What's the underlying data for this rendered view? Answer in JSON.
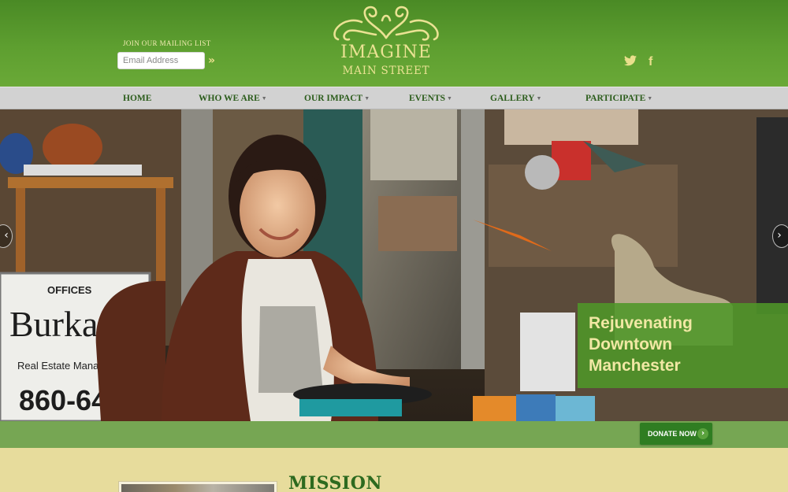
{
  "header": {
    "mailing_label": "JOIN OUR MAILING LIST",
    "email_placeholder": "Email Address",
    "submit_icon": "double-chevron-right-icon",
    "logo_line1": "IMAGINE",
    "logo_line2": "MAIN STREET",
    "social": [
      "twitter-icon",
      "facebook-icon"
    ]
  },
  "nav": {
    "items": [
      {
        "label": "HOME",
        "dropdown": false
      },
      {
        "label": "WHO WE ARE",
        "dropdown": true
      },
      {
        "label": "OUR IMPACT",
        "dropdown": true
      },
      {
        "label": "EVENTS",
        "dropdown": true
      },
      {
        "label": "GALLERY",
        "dropdown": true
      },
      {
        "label": "PARTICIPATE",
        "dropdown": true
      }
    ]
  },
  "hero": {
    "caption_line1": "Rejuvenating",
    "caption_line2": "Downtown",
    "caption_line3": "Manchester",
    "sign_offices": "OFFICES",
    "sign_name": "Burkam",
    "sign_sub": "Real Estate Manage",
    "sign_phone": "860-647"
  },
  "cta": {
    "donate_label": "DONATE NOW"
  },
  "main": {
    "mission_title": "MISSION"
  },
  "colors": {
    "header_green": "#5e9f30",
    "logo_cream": "#eae293",
    "nav_bg": "#d2d2d2",
    "nav_text": "#2c5d1c",
    "bar_green": "#76a653",
    "donate_green": "#2f7d22",
    "page_cream": "#e7dc9c"
  }
}
